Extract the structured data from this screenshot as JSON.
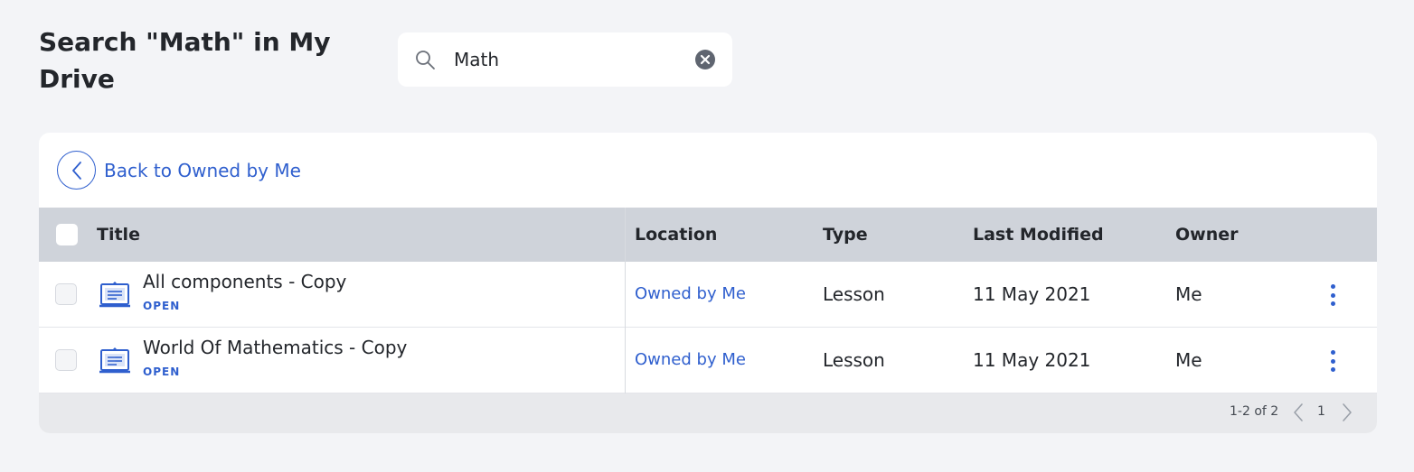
{
  "header": {
    "title": "Search \"Math\" in My Drive"
  },
  "search": {
    "value": "Math",
    "search_icon": "search-icon",
    "clear_icon": "clear-circle-icon"
  },
  "back": {
    "label": "Back to Owned by Me",
    "icon": "chevron-left-icon"
  },
  "table": {
    "columns": {
      "title": "Title",
      "location": "Location",
      "type": "Type",
      "last_modified": "Last Modified",
      "owner": "Owner"
    },
    "rows": [
      {
        "title": "All components - Copy",
        "action": "OPEN",
        "location": "Owned by Me",
        "type": "Lesson",
        "last_modified": "11 May 2021",
        "owner": "Me",
        "icon": "lesson-icon"
      },
      {
        "title": "World Of Mathematics - Copy",
        "action": "OPEN",
        "location": "Owned by Me",
        "type": "Lesson",
        "last_modified": "11 May 2021",
        "owner": "Me",
        "icon": "lesson-icon"
      }
    ]
  },
  "pagination": {
    "range": "1-2 of 2",
    "page": "1"
  },
  "colors": {
    "accent": "#2f5fce",
    "background": "#f3f4f7",
    "header_row": "#cfd3da",
    "footer": "#e8e9ec"
  }
}
